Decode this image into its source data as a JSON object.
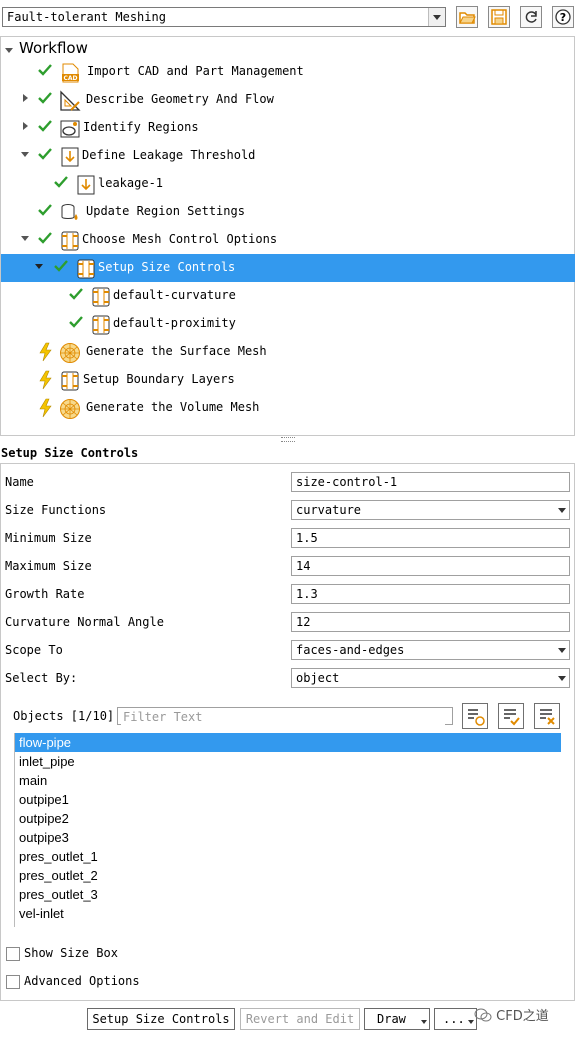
{
  "toolbar": {
    "workflow_value": "Fault-tolerant Meshing",
    "icons": [
      "open-folder-icon",
      "save-icon",
      "refresh-icon",
      "help-icon"
    ]
  },
  "tree": {
    "title": "Workflow",
    "items": [
      {
        "label": "Import CAD and Part Management",
        "status": "done",
        "icon": "cad-icon"
      },
      {
        "label": "Describe Geometry And Flow",
        "status": "done",
        "icon": "geometry-icon"
      },
      {
        "label": "Identify Regions",
        "status": "done",
        "icon": "regions-icon"
      },
      {
        "label": "Define Leakage Threshold",
        "status": "done",
        "icon": "leakage-icon"
      },
      {
        "label": "leakage-1",
        "status": "done",
        "icon": "leakage-icon"
      },
      {
        "label": "Update Region Settings",
        "status": "done",
        "icon": "region-settings-icon"
      },
      {
        "label": "Choose Mesh Control Options",
        "status": "done",
        "icon": "mesh-control-icon"
      },
      {
        "label": "Setup Size Controls",
        "status": "done",
        "icon": "size-control-icon",
        "selected": true
      },
      {
        "label": "default-curvature",
        "status": "done",
        "icon": "size-control-icon"
      },
      {
        "label": "default-proximity",
        "status": "done",
        "icon": "size-control-icon"
      },
      {
        "label": "Generate the Surface Mesh",
        "status": "pending",
        "icon": "surface-mesh-icon"
      },
      {
        "label": "Setup Boundary Layers",
        "status": "pending",
        "icon": "boundary-layer-icon"
      },
      {
        "label": "Generate the Volume Mesh",
        "status": "pending",
        "icon": "volume-mesh-icon"
      }
    ]
  },
  "task": {
    "title": "Setup Size Controls",
    "fields": [
      {
        "label": "Name",
        "value": "size-control-1"
      },
      {
        "label": "Size Functions",
        "value": "curvature"
      },
      {
        "label": "Minimum Size",
        "value": "1.5"
      },
      {
        "label": "Maximum Size",
        "value": "14"
      },
      {
        "label": "Growth Rate",
        "value": "1.3"
      },
      {
        "label": "Curvature Normal Angle",
        "value": "12"
      },
      {
        "label": "Scope To",
        "value": "faces-and-edges"
      },
      {
        "label": "Select By:",
        "value": "object"
      }
    ],
    "objects_label": "Objects [1/10]",
    "filter_placeholder": "Filter Text",
    "objects": [
      "flow-pipe",
      "inlet_pipe",
      "main",
      "outpipe1",
      "outpipe2",
      "outpipe3",
      "pres_outlet_1",
      "pres_outlet_2",
      "pres_outlet_3",
      "vel-inlet"
    ],
    "show_size_box": "Show Size Box",
    "advanced_options": "Advanced Options"
  },
  "buttons": {
    "primary": "Setup Size Controls",
    "revert": "Revert and Edit",
    "draw": "Draw",
    "more": "..."
  },
  "watermark": "CFD之道",
  "colors": {
    "selection": "#3399ee",
    "check": "#2e9e2e",
    "pending": "#f5c400",
    "icon_orange": "#e08a00"
  }
}
